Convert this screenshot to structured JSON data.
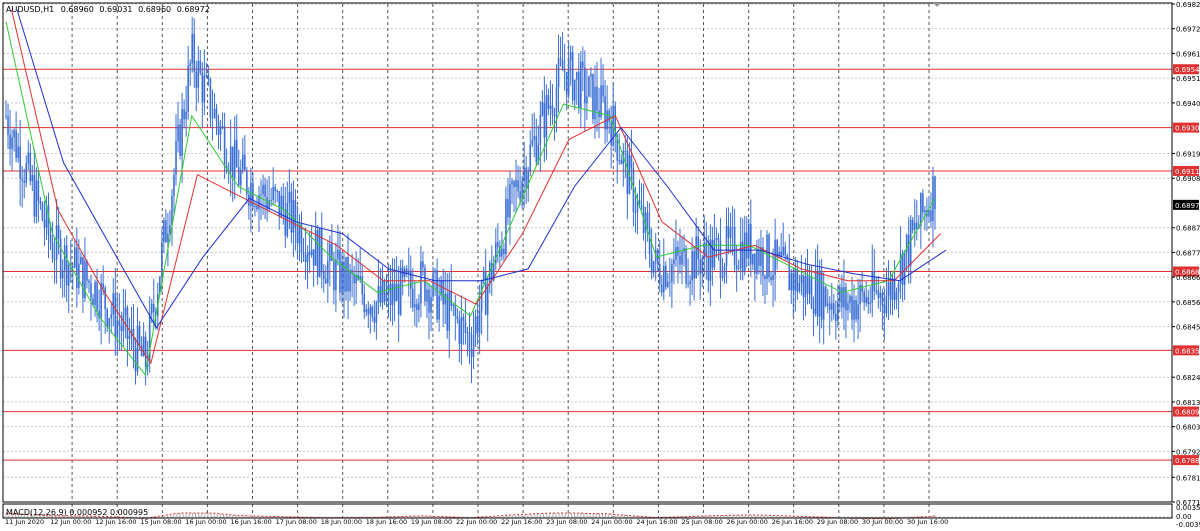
{
  "header": {
    "symbol_label": "AUDUSD,H1",
    "ohlc": [
      "0.68960",
      "0.69031",
      "0.68960",
      "0.68972"
    ]
  },
  "colors": {
    "background": "#ffffff",
    "grid": "#c8c8c8",
    "candles": "#3b6fd4",
    "ma_fast": "#2ecc2e",
    "ma_mid": "#e03030",
    "ma_slow": "#1f2fd0",
    "level_line": "#e03030",
    "current_price_badge": "#000000",
    "macd_histogram": "#b0b0b0",
    "macd_signal": "#e03030"
  },
  "chart_data": {
    "type": "line",
    "title": "AUDUSD,H1",
    "xlabel": "",
    "ylabel": "",
    "ylim": [
      0.6771,
      0.69825
    ],
    "grid": true,
    "price_ticks": [
      "0.69825",
      "0.69720",
      "0.69615",
      "0.69510",
      "0.69405",
      "0.69190",
      "0.69085",
      "0.68875",
      "0.68770",
      "0.68665",
      "0.68560",
      "0.68455",
      "0.68240",
      "0.68135",
      "0.68030",
      "0.67925",
      "0.67815",
      "0.67710"
    ],
    "x_labels": [
      "11 Jun 2020",
      "12 Jun 00:00",
      "12 Jun 16:00",
      "15 Jun 08:00",
      "16 Jun 00:00",
      "16 Jun 16:00",
      "17 Jun 08:00",
      "18 Jun 00:00",
      "18 Jun 16:00",
      "19 Jun 08:00",
      "22 Jun 00:00",
      "22 Jun 16:00",
      "23 Jun 08:00",
      "24 Jun 00:00",
      "24 Jun 16:00",
      "25 Jun 08:00",
      "26 Jun 00:00",
      "26 Jun 16:00",
      "29 Jun 08:00",
      "30 Jun 00:00",
      "30 Jun 16:00"
    ],
    "horizontal_levels": [
      0.69548,
      0.693,
      0.69116,
      0.68689,
      0.68354,
      0.68094,
      0.67888
    ],
    "current_price": 0.68972,
    "price_path": {
      "x": [
        0,
        1,
        2,
        3,
        4,
        5,
        6,
        7,
        8,
        9,
        10,
        11,
        12,
        13,
        14,
        15,
        16,
        17,
        18,
        19,
        20
      ],
      "y": [
        0.6935,
        0.688,
        0.686,
        0.683,
        0.696,
        0.691,
        0.6895,
        0.687,
        0.6855,
        0.6865,
        0.684,
        0.6905,
        0.6955,
        0.6935,
        0.687,
        0.6875,
        0.688,
        0.6865,
        0.6855,
        0.686,
        0.6905
      ]
    },
    "series": [
      {
        "x": [
          0,
          1,
          2,
          3,
          4,
          5,
          6,
          7,
          8,
          9,
          10,
          11,
          12,
          13,
          14,
          15,
          16,
          17,
          18,
          19,
          20
        ],
        "values": [
          0.6975,
          0.6885,
          0.685,
          0.6825,
          0.6935,
          0.6905,
          0.6895,
          0.6875,
          0.686,
          0.6865,
          0.685,
          0.6895,
          0.694,
          0.6935,
          0.6875,
          0.688,
          0.688,
          0.687,
          0.686,
          0.6865,
          0.69
        ]
      },
      {
        "x": [
          0,
          1,
          2,
          3,
          4,
          5,
          6,
          7,
          8,
          9,
          10,
          11,
          12,
          13,
          14,
          15,
          16,
          17,
          18,
          19,
          20
        ],
        "values": [
          0.698,
          0.6895,
          0.686,
          0.683,
          0.691,
          0.69,
          0.689,
          0.688,
          0.6865,
          0.6865,
          0.6855,
          0.6885,
          0.6925,
          0.6935,
          0.689,
          0.6875,
          0.688,
          0.687,
          0.6865,
          0.6865,
          0.6885
        ]
      },
      {
        "x": [
          0,
          1,
          2,
          3,
          4,
          5,
          6,
          7,
          8,
          9,
          10,
          11,
          12,
          13,
          14,
          15,
          16,
          17,
          18,
          19,
          20
        ],
        "values": [
          0.698,
          0.6915,
          0.688,
          0.6845,
          0.6875,
          0.69,
          0.689,
          0.6885,
          0.687,
          0.6865,
          0.6865,
          0.687,
          0.6905,
          0.693,
          0.6905,
          0.6878,
          0.6878,
          0.6872,
          0.6868,
          0.6865,
          0.6878
        ]
      }
    ],
    "macd": {
      "label": "MACD(12,26,9) 0.000952 0.000995",
      "ylim": [
        -0.00397,
        0.00353
      ],
      "ticks": [
        "0.00353",
        "0.00",
        "-0.00397"
      ]
    }
  }
}
